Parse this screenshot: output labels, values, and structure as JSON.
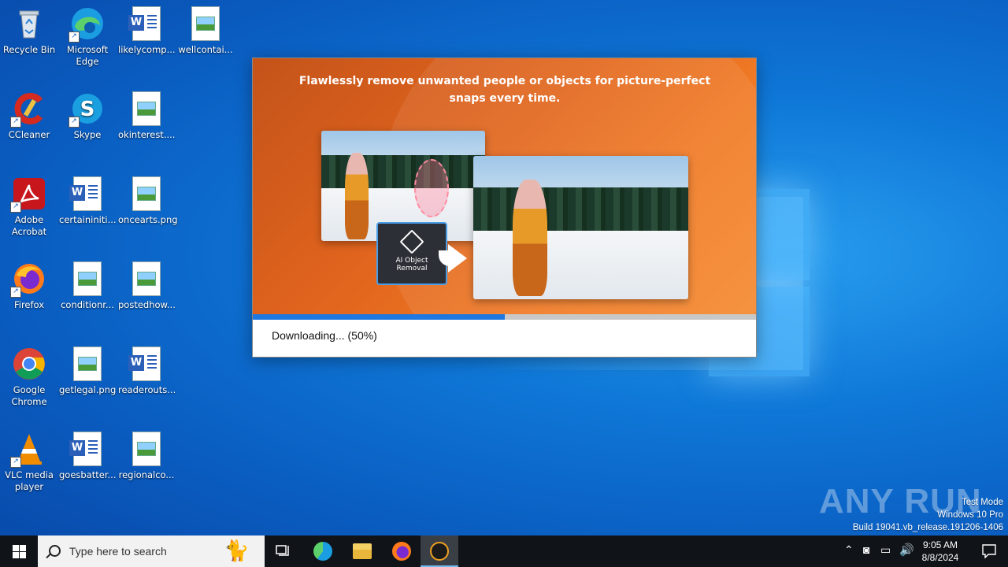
{
  "desktop": {
    "icons": [
      {
        "label": "Recycle Bin",
        "icon": "recycle-bin-icon"
      },
      {
        "label": "Microsoft Edge",
        "icon": "edge-icon"
      },
      {
        "label": "likelycomp...",
        "icon": "word-doc-icon"
      },
      {
        "label": "wellcontai...",
        "icon": "image-file-icon"
      },
      {
        "label": "CCleaner",
        "icon": "ccleaner-icon"
      },
      {
        "label": "Skype",
        "icon": "skype-icon"
      },
      {
        "label": "okinterest....",
        "icon": "image-file-icon"
      },
      {
        "label": "Adobe Acrobat",
        "icon": "acrobat-icon"
      },
      {
        "label": "certaininiti...",
        "icon": "word-doc-icon"
      },
      {
        "label": "oncearts.png",
        "icon": "image-file-icon"
      },
      {
        "label": "Firefox",
        "icon": "firefox-icon"
      },
      {
        "label": "conditionr...",
        "icon": "image-file-icon"
      },
      {
        "label": "postedhow...",
        "icon": "image-file-icon"
      },
      {
        "label": "Google Chrome",
        "icon": "chrome-icon"
      },
      {
        "label": "getlegal.png",
        "icon": "image-file-icon"
      },
      {
        "label": "readerouts...",
        "icon": "word-doc-icon"
      },
      {
        "label": "VLC media player",
        "icon": "vlc-icon"
      },
      {
        "label": "goesbatter...",
        "icon": "word-doc-icon"
      },
      {
        "label": "regionalco...",
        "icon": "image-file-icon"
      }
    ]
  },
  "installer": {
    "headline": "Flawlessly remove unwanted people or objects for picture-perfect snaps every time.",
    "badge_line1": "AI Object",
    "badge_line2": "Removal",
    "progress": 0.5,
    "status": "Downloading... (50%)"
  },
  "watermark": {
    "brand": "ANY RUN",
    "line1": "Test Mode",
    "line2": "Windows 10 Pro",
    "line3": "Build 19041.vb_release.191206-1406"
  },
  "taskbar": {
    "search_placeholder": "Type here to search",
    "time": "9:05 AM",
    "date": "8/8/2024"
  },
  "colors": {
    "accent": "#1e78e0",
    "banner": "#e0641d",
    "taskbar": "#101418"
  }
}
